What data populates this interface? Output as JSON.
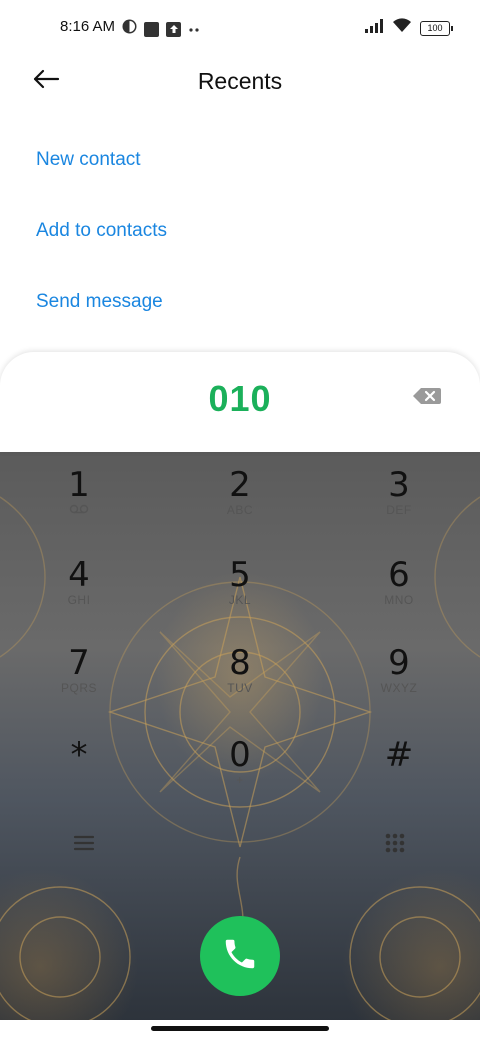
{
  "status_bar": {
    "time": "8:16 AM",
    "battery": "100",
    "icons": [
      "vpn-icon",
      "square-notification-icon",
      "upload-icon",
      "more-dots-icon",
      "signal-icon",
      "wifi-icon",
      "battery-icon"
    ]
  },
  "header": {
    "title": "Recents",
    "back_icon": "back-arrow-icon"
  },
  "actions": [
    {
      "label": "New contact"
    },
    {
      "label": "Add to contacts"
    },
    {
      "label": "Send message"
    }
  ],
  "dialer": {
    "number": "010",
    "backspace_icon": "backspace-icon"
  },
  "keypad": [
    {
      "digit": "1",
      "letters": ""
    },
    {
      "digit": "2",
      "letters": "ABC"
    },
    {
      "digit": "3",
      "letters": "DEF"
    },
    {
      "digit": "4",
      "letters": "GHI"
    },
    {
      "digit": "5",
      "letters": "JKL"
    },
    {
      "digit": "6",
      "letters": "MNO"
    },
    {
      "digit": "7",
      "letters": "PQRS"
    },
    {
      "digit": "8",
      "letters": "TUV"
    },
    {
      "digit": "9",
      "letters": "WXYZ"
    },
    {
      "digit": "*",
      "letters": ""
    },
    {
      "digit": "0",
      "letters": "+"
    },
    {
      "digit": "#",
      "letters": ""
    }
  ],
  "bottom": {
    "menu_icon": "menu-icon",
    "keypad_toggle_icon": "keypad-grid-icon",
    "call_icon": "phone-icon"
  },
  "colors": {
    "accent": "#1a86e0",
    "number": "#1bb05a",
    "call": "#1fc15b"
  }
}
